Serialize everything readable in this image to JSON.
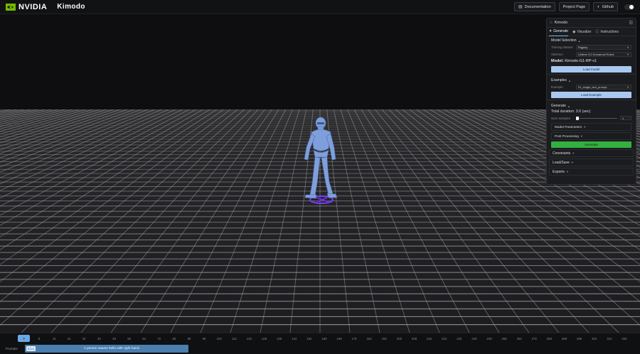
{
  "header": {
    "brand": "NVIDIA",
    "app_title": "Kimodo",
    "links": [
      {
        "label": "Documentation",
        "icon": "doc-icon"
      },
      {
        "label": "Project Page",
        "icon": ""
      },
      {
        "label": "Github",
        "icon": "github-icon"
      }
    ],
    "theme_toggle": "dark-mode-toggle"
  },
  "panel": {
    "title": "Kimodo",
    "tabs": [
      {
        "label": "Generate",
        "icon": "run-icon",
        "active": true
      },
      {
        "label": "Visualize",
        "icon": "eye-icon",
        "active": false
      },
      {
        "label": "Instructions",
        "icon": "info-icon",
        "active": false
      }
    ],
    "model_selection": {
      "title": "Model Selection",
      "training_dataset_label": "Training dataset",
      "training_dataset_value": "Rigplay",
      "skeleton_label": "Skeleton",
      "skeleton_value": "Unitree G1 Humanoid Robot",
      "model_prefix": "Model:",
      "model_name": "Kimodo-G1-RP-v1",
      "load_model_label": "Load model"
    },
    "examples": {
      "title": "Examples",
      "example_label": "Example",
      "example_value": "01_single_text_prompt",
      "load_example_label": "Load Example"
    },
    "generate": {
      "title": "Generate",
      "total_duration": "Total duration: 3.0 (sec)",
      "num_samples_label": "Num Samples",
      "num_samples_value": "1",
      "num_samples_fraction": 0.0,
      "model_parameters_label": "Model Parameters",
      "post_processing_label": "Post Processing",
      "generate_label": "Generate"
    },
    "folds": [
      "Constraints",
      "Load/Save",
      "Exports"
    ]
  },
  "timeline": {
    "current_frame": "0",
    "ticks": [
      "8",
      "16",
      "24",
      "32",
      "40",
      "48",
      "56",
      "64",
      "72",
      "80",
      "88",
      "96",
      "104",
      "112",
      "120",
      "128",
      "136",
      "144",
      "152",
      "160",
      "168",
      "176",
      "184",
      "192",
      "200",
      "208",
      "216",
      "224",
      "232",
      "240",
      "248",
      "256",
      "264",
      "272",
      "280",
      "288",
      "296",
      "304",
      "312",
      "320"
    ],
    "prompts_label": "Prompts",
    "prompt_duration": "3.0 s",
    "prompt_text": "A person waves hello with right hand."
  },
  "colors": {
    "accent_blue": "#a8c8f0",
    "generate_green": "#33b040",
    "robot": "#7f9fdc",
    "root_marker": "#7a3cff"
  }
}
